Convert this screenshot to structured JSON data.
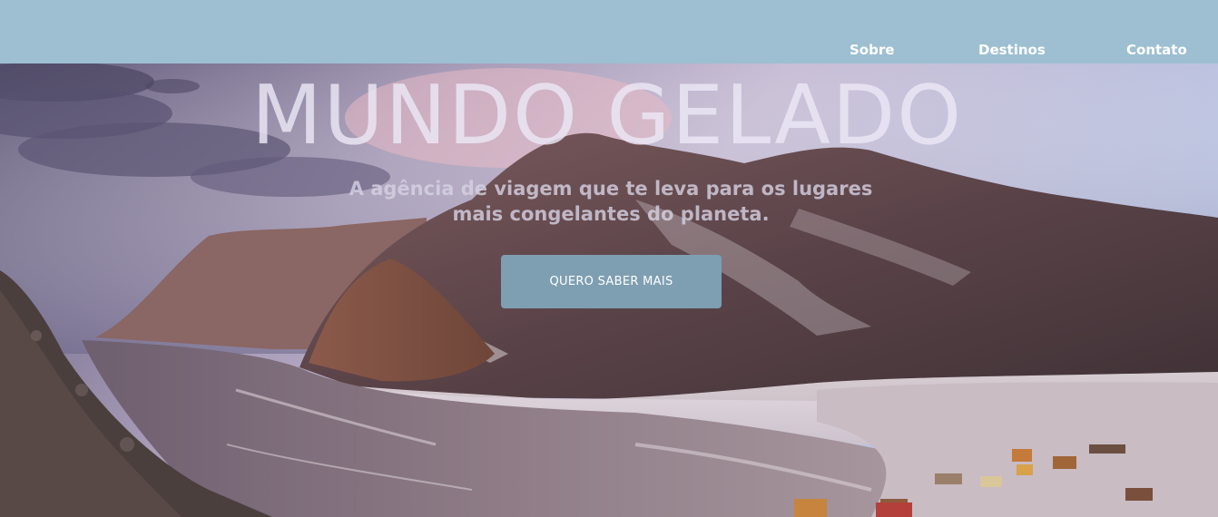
{
  "nav": {
    "items": [
      {
        "label": "Sobre"
      },
      {
        "label": "Destinos"
      },
      {
        "label": "Contato"
      }
    ]
  },
  "hero": {
    "title": "MUNDO GELADO",
    "subtitle": "A agência de viagem que te leva para os lugares mais congelantes do planeta.",
    "cta_label": "QUERO SABER MAIS"
  },
  "colors": {
    "navbar_bg": "#9dbfd1",
    "cta_bg": "#7e9fb1",
    "nav_text": "#ffffff"
  }
}
